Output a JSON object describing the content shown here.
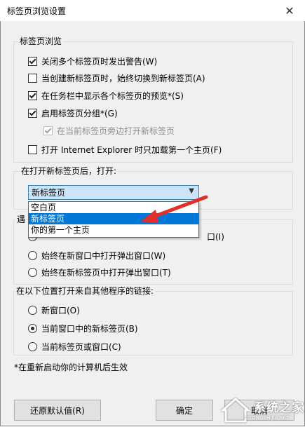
{
  "window": {
    "title": "标签页浏览设置",
    "close_glyph": "✕"
  },
  "tab_browsing": {
    "legend": "标签页浏览",
    "options": [
      {
        "label": "关闭多个标签页时发出警告(W)",
        "checked": true,
        "disabled": false
      },
      {
        "label": "当创建新标签页时，始终切换到新标签页(A)",
        "checked": false,
        "disabled": false
      },
      {
        "label": "在任务栏中显示各个标签页的预览*(S)",
        "checked": true,
        "disabled": false
      },
      {
        "label": "启用标签页分组*(G)",
        "checked": true,
        "disabled": false
      },
      {
        "label": "在当前标签页旁边打开新标签页",
        "checked": true,
        "disabled": true
      },
      {
        "label": "打开 Internet Explorer 时只加载第一个主页(F)",
        "checked": false,
        "disabled": false
      }
    ]
  },
  "new_tab": {
    "legend": "在打开新标签页后，打开:",
    "selected": "新标签页",
    "options": [
      "空白页",
      "新标签页",
      "你的第一个主页"
    ],
    "highlighted_index": 1
  },
  "popups": {
    "legend_partial": "遇",
    "options": [
      {
        "label": "口(I)",
        "selected": false
      },
      {
        "label": "始终在新窗口中打开弹出窗口(W)",
        "selected": false
      },
      {
        "label": "始终在新标签页中打开弹出窗口(T)",
        "selected": false
      }
    ]
  },
  "links": {
    "legend": "在以下位置打开来自其他程序的链接:",
    "options": [
      {
        "label": "新窗口(O)",
        "selected": false
      },
      {
        "label": "当前窗口中的新标签页(B)",
        "selected": true
      },
      {
        "label": "当前标签页或窗口(C)",
        "selected": false
      }
    ]
  },
  "note": "*在重新启动你的计算机后生效",
  "buttons": {
    "restore": "还原默认值(R)",
    "ok": "确定",
    "cancel": "取消"
  },
  "annotation_color": "#e0302a",
  "watermark": {
    "main": "系统之家",
    "sub": "XITONGZHIJIA.NET"
  }
}
